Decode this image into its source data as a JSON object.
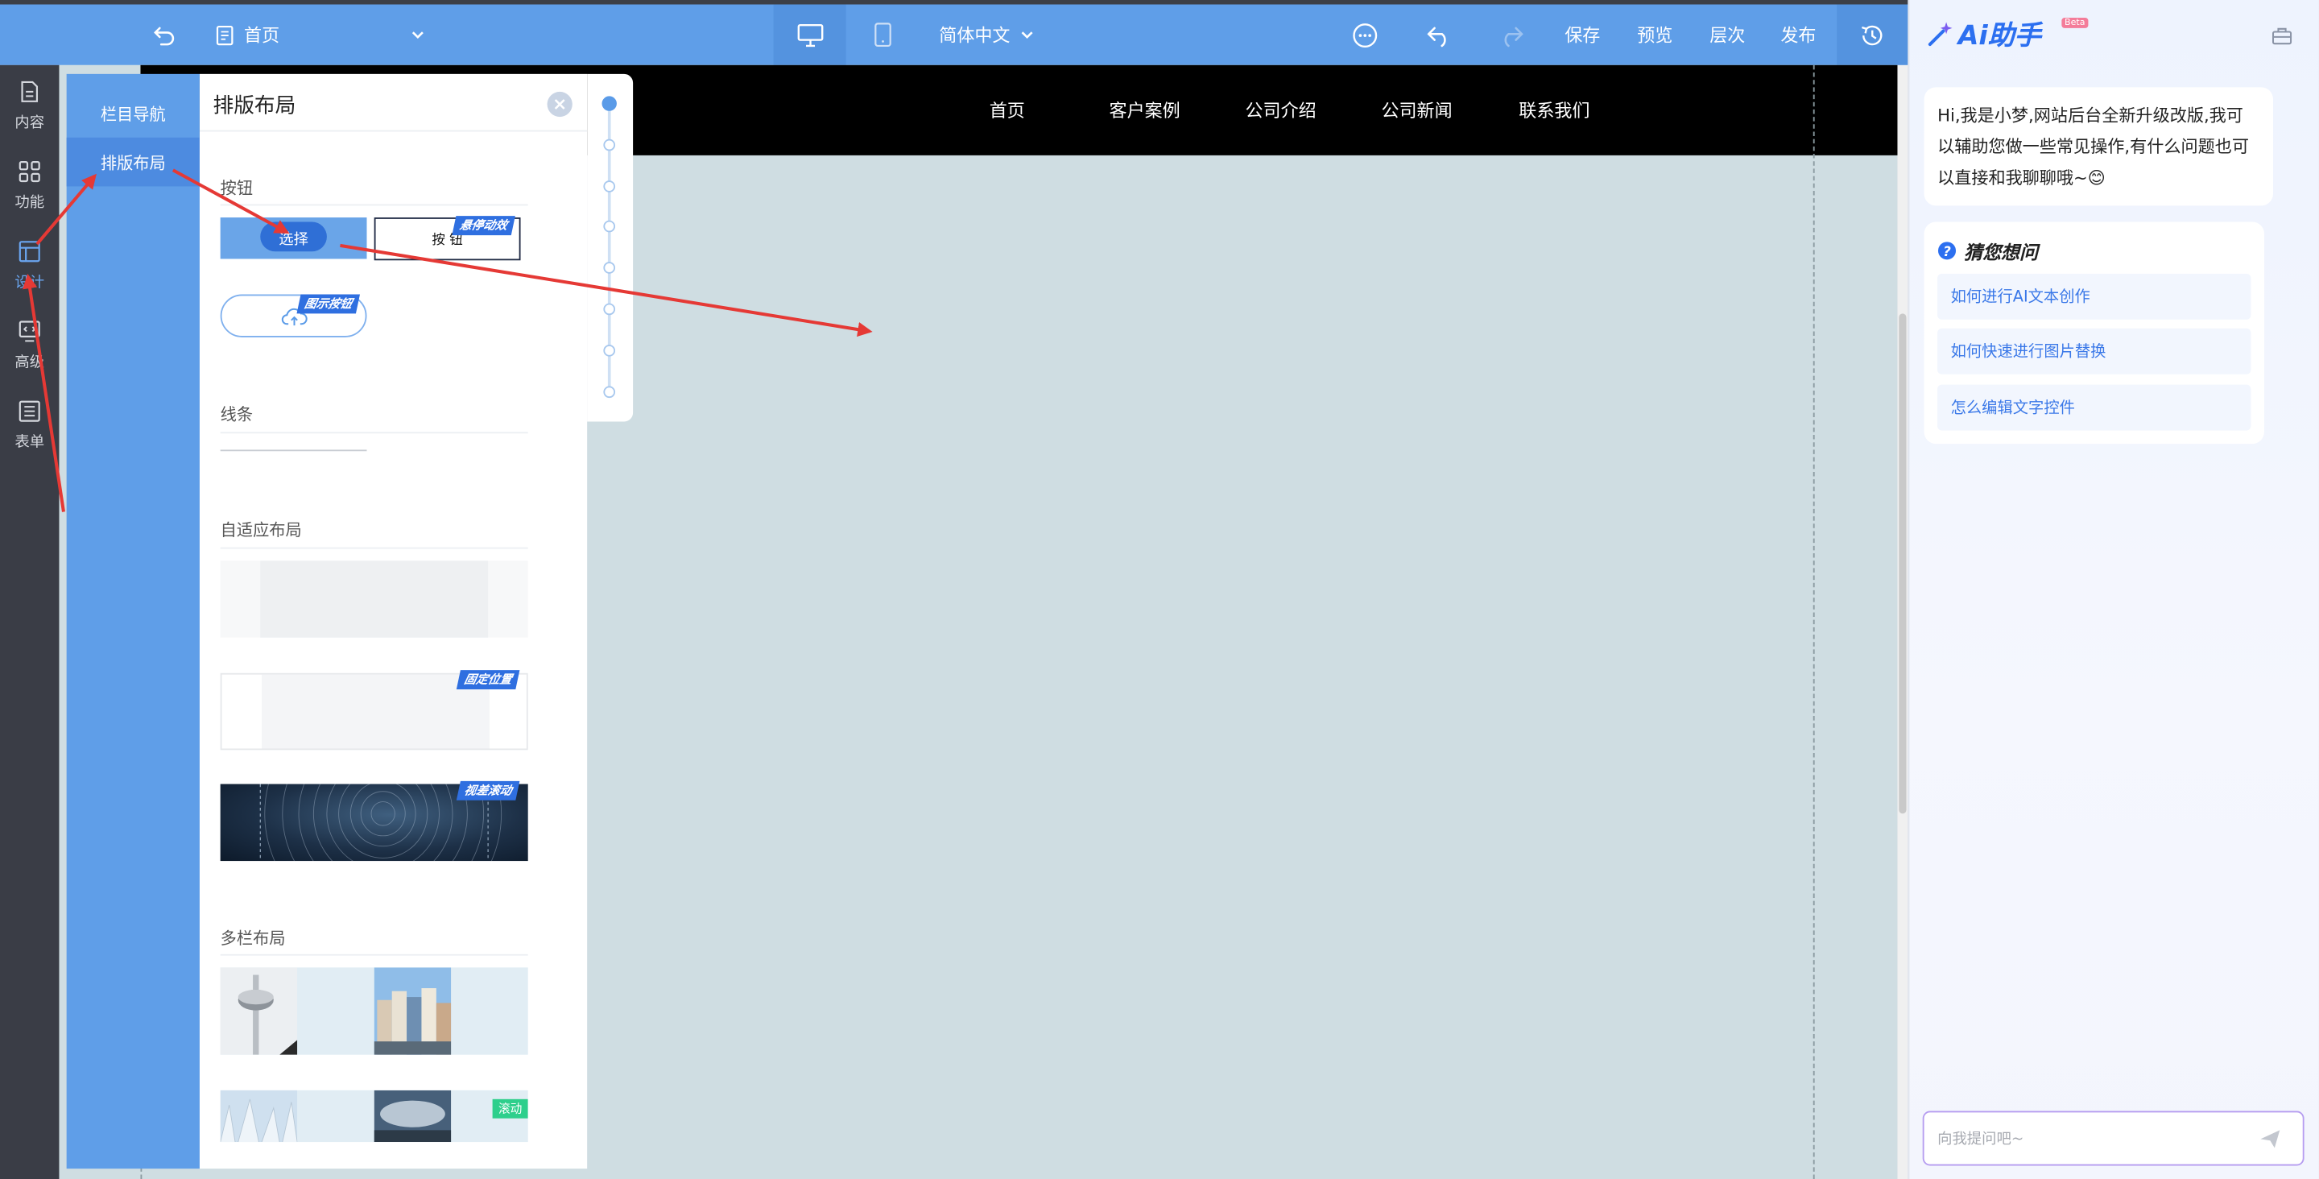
{
  "toolbar": {
    "page_selector": "首页",
    "language": "简体中文",
    "save": "保存",
    "preview": "预览",
    "layers": "层次",
    "publish": "发布",
    "icons": [
      "back-icon",
      "page-icon",
      "desktop-icon",
      "mobile-icon",
      "more-icon",
      "undo-icon",
      "redo-icon",
      "history-icon"
    ]
  },
  "rail": {
    "items": [
      {
        "label": "内容",
        "icon": "content-icon"
      },
      {
        "label": "功能",
        "icon": "grid-icon"
      },
      {
        "label": "设计",
        "icon": "layout-icon",
        "active": true
      },
      {
        "label": "高级",
        "icon": "code-icon"
      },
      {
        "label": "表单",
        "icon": "form-icon"
      }
    ]
  },
  "panel": {
    "tabs": [
      "栏目导航",
      "排版布局"
    ],
    "active_tab": "排版布局",
    "title": "排版布局",
    "sections": {
      "buttons": "按钮",
      "lines": "线条",
      "adaptive": "自适应布局",
      "multi": "多栏布局"
    },
    "button_select": "选择",
    "button_plain": "按 钮",
    "ribbons": {
      "hover": "悬停动效",
      "icon_button": "图示按钮",
      "fixed": "固定位置",
      "video": "视差滚动"
    },
    "badge_scroll": "滚动"
  },
  "site": {
    "nav": [
      "首页",
      "客户案例",
      "公司介绍",
      "公司新闻",
      "联系我们"
    ]
  },
  "ai": {
    "title": "Ai助手",
    "beta": "Beta",
    "greeting": "Hi,我是小梦,网站后台全新升级改版,我可以辅助您做一些常见操作,有什么问题也可以直接和我聊聊哦~😊",
    "guess_title": "猜您想问",
    "questions": [
      "如何进行AI文本创作",
      "如何快速进行图片替换",
      "怎么编辑文字控件"
    ],
    "input_placeholder": "向我提问吧~"
  },
  "colors": {
    "toolbar": "#5f9ee8",
    "rail": "#3a3d46",
    "accent": "#2c6ff0",
    "arrow": "#e53935"
  }
}
